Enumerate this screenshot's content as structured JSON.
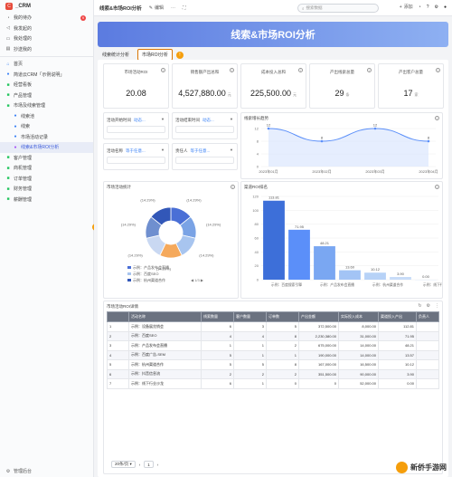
{
  "app": {
    "logo_letter": "C",
    "name": "_CRM"
  },
  "sidebar": {
    "top_items": [
      {
        "label": "我的待办",
        "icon": "bell-icon",
        "badge": "9"
      },
      {
        "label": "我发起的",
        "icon": "send-icon"
      },
      {
        "label": "我处理的",
        "icon": "doc-icon"
      },
      {
        "label": "抄送我的",
        "icon": "copy-icon"
      }
    ],
    "items": [
      {
        "label": "首页",
        "icon": "home-icon"
      },
      {
        "label": "简道云CRM「示例说明」",
        "icon": "info-icon"
      },
      {
        "label": "经营看板",
        "icon": "folder-icon"
      },
      {
        "label": "产品管理",
        "icon": "folder-icon"
      },
      {
        "label": "市场及线索管理",
        "icon": "folder-open-icon"
      }
    ],
    "sub_items": [
      {
        "label": "线索池",
        "icon": "list-icon"
      },
      {
        "label": "线索",
        "icon": "user-icon"
      },
      {
        "label": "市场活动记录",
        "icon": "calendar-icon"
      },
      {
        "label": "线索&市场ROI分析",
        "icon": "chart-icon"
      }
    ],
    "more_items": [
      {
        "label": "客户管理",
        "icon": "folder-icon"
      },
      {
        "label": "商机管理",
        "icon": "folder-icon"
      },
      {
        "label": "订单管理",
        "icon": "folder-icon"
      },
      {
        "label": "财务管理",
        "icon": "folder-icon"
      },
      {
        "label": "薪酬管理",
        "icon": "folder-icon"
      }
    ],
    "footer": "管理后台"
  },
  "topbar": {
    "title": "线索&市场ROI分析",
    "edit": "编辑",
    "search_placeholder": "搜索数据",
    "add": "添加"
  },
  "banner": {
    "title": "线索&市场ROI分析"
  },
  "tabs": [
    {
      "label": "线索统计分析",
      "active": false
    },
    {
      "label": "市场ROI分析",
      "active": true
    }
  ],
  "tab_warn": "!",
  "side_warn": "!",
  "kpis": [
    {
      "label": "市场活动ROI",
      "value": "20.08",
      "unit": ""
    },
    {
      "label": "销售额产出总和",
      "value": "4,527,880.00",
      "unit": "元"
    },
    {
      "label": "成本投入总和",
      "value": "225,500.00",
      "unit": "元"
    },
    {
      "label": "产出线索总量",
      "value": "29",
      "unit": "条"
    },
    {
      "label": "产出客户总量",
      "value": "17",
      "unit": "家"
    }
  ],
  "filters": [
    {
      "label": "活动开始时间",
      "value": "动态..."
    },
    {
      "label": "活动结束时间",
      "value": "动态..."
    },
    {
      "label": "活动名称",
      "value": "等于任意..."
    },
    {
      "label": "责任人",
      "value": "等于任意..."
    }
  ],
  "line_card": {
    "title": "线索增长趋势"
  },
  "pie_card": {
    "title": "市场活动统计"
  },
  "bar_card": {
    "title": "渠道ROI排名"
  },
  "table_card": {
    "title": "市场活动ROI详情"
  },
  "chart_data": [
    {
      "type": "line",
      "title": "线索增长趋势",
      "x": [
        "2023年01月",
        "2023年02月",
        "2023年03月",
        "2023年04月"
      ],
      "y": [
        12,
        8,
        12,
        8
      ],
      "point_labels": [
        "12",
        "8",
        "12",
        "8"
      ],
      "yticks": [
        "12",
        "8",
        "4",
        "0"
      ],
      "ylim": [
        0,
        12
      ],
      "color": "#5b8ff9"
    },
    {
      "type": "pie",
      "title": "市场活动统计",
      "slices": [
        {
          "label": "(14.29%)",
          "value": 14.29,
          "color": "#4a6fd6"
        },
        {
          "label": "(14.29%)",
          "value": 14.29,
          "color": "#7aa3e5"
        },
        {
          "label": "(14.29%)",
          "value": 14.29,
          "color": "#a8c5ef"
        },
        {
          "label": "(14.29%)",
          "value": 14.29,
          "color": "#f5a95c"
        },
        {
          "label": "(14.29%)",
          "value": 14.29,
          "color": "#c9d8f2"
        },
        {
          "label": "(14.29%)",
          "value": 14.29,
          "color": "#6f8fcf"
        },
        {
          "label": "(14.29%)",
          "value": 14.29,
          "color": "#3257b8"
        }
      ],
      "legend": [
        {
          "label": "示例：产品发布会直播",
          "color": "#4a6fd6"
        },
        {
          "label": "示例：百度SEO",
          "color": "#a8c5ef"
        },
        {
          "label": "示例：杭州渠道合作",
          "color": "#3257b8"
        }
      ],
      "legend_pager": "1/3"
    },
    {
      "type": "bar",
      "title": "渠道ROI排名",
      "categories": [
        "示例：百度搜索引擎",
        "示例：产品发布会直播",
        "示例：杭州渠道合作",
        "示例：线下行业沙龙"
      ],
      "values": [
        113.81,
        71.95,
        48.21,
        13.6,
        10.12,
        3.9,
        0.0
      ],
      "value_labels": [
        "113.81",
        "71.95",
        "48.21",
        "13.60",
        "10.12",
        "3.90",
        "0.00"
      ],
      "yticks": [
        "120",
        "100",
        "80",
        "60",
        "40",
        "20",
        "0"
      ],
      "ylim": [
        0,
        120
      ],
      "colors": [
        "#3d6fd9",
        "#5b8ff9",
        "#7aa7f2",
        "#a3c4f5",
        "#b7d2f7",
        "#c8dcf8",
        "#d8e6fa"
      ]
    }
  ],
  "table": {
    "headers": [
      "活动名称",
      "线索数量",
      "客户数量",
      "订单数",
      "产出金额",
      "实际投入成本",
      "渠道投入产出",
      "负责人"
    ],
    "rows": [
      {
        "no": "1",
        "cells": [
          "示例：设备展览销会",
          "6",
          "3",
          "5",
          "372,500.00",
          "8,000.00",
          "112.81",
          ""
        ]
      },
      {
        "no": "2",
        "cells": [
          "示例：百度SEO",
          "4",
          "4",
          "8",
          "2,230,380.00",
          "31,000.00",
          "71.95",
          ""
        ]
      },
      {
        "no": "3",
        "cells": [
          "示例：产品发布会直播",
          "1",
          "1",
          "2",
          "675,000.00",
          "14,000.00",
          "48.21",
          ""
        ]
      },
      {
        "no": "4",
        "cells": [
          "示例：百度广告-SEM",
          "5",
          "1",
          "1",
          "190,000.00",
          "14,000.00",
          "13.57",
          ""
        ]
      },
      {
        "no": "5",
        "cells": [
          "示例：杭州渠道合作",
          "5",
          "5",
          "8",
          "167,000.00",
          "16,500.00",
          "10.12",
          ""
        ]
      },
      {
        "no": "6",
        "cells": [
          "示例：抖音信息流",
          "2",
          "2",
          "2",
          "351,500.00",
          "90,000.00",
          "3.90",
          ""
        ]
      },
      {
        "no": "7",
        "cells": [
          "示例：线下行业沙龙",
          "6",
          "1",
          "0",
          "0",
          "52,000.00",
          "0.00",
          ""
        ]
      }
    ]
  },
  "pager": {
    "size": "20条/页",
    "page": "1"
  },
  "watermark": "新侨手游网"
}
